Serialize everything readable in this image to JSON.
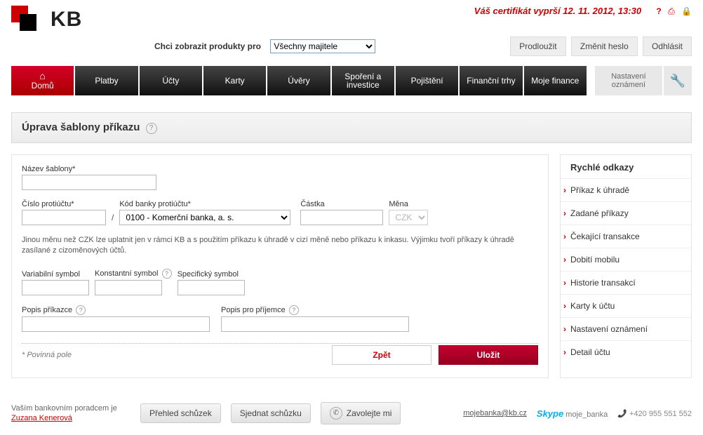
{
  "header": {
    "logo_text": "KB",
    "cert_warning": "Váš certifikát vyprší 12. 11. 2012, 13:30",
    "produkty_label": "Chci zobrazit produkty pro",
    "produkty_select": "Všechny majitele",
    "btn_prodlouzit": "Prodloužit",
    "btn_zmenit_heslo": "Změnit heslo",
    "btn_odhlasit": "Odhlásit"
  },
  "nav": {
    "domu": "Domů",
    "platby": "Platby",
    "ucty": "Účty",
    "karty": "Karty",
    "uvery": "Úvěry",
    "sporeni": "Spoření a investice",
    "pojisteni": "Pojištění",
    "trhy": "Finanční trhy",
    "finance": "Moje finance",
    "nastaveni": "Nastavení oznámení"
  },
  "title": "Úprava šablony příkazu",
  "form": {
    "nazev_label": "Název šablony*",
    "cislo_label": "Číslo protiúčtu*",
    "kod_label": "Kód banky protiúčtu*",
    "kod_value": "0100 - Komerční banka, a. s.",
    "castka_label": "Částka",
    "mena_label": "Měna",
    "mena_value": "CZK",
    "note": "Jinou měnu než CZK lze uplatnit jen v rámci KB a s použitím příkazu k úhradě v cizí měně nebo příkazu k inkasu. Výjimku tvoří příkazy k úhradě zasílané z cizoměnových účtů.",
    "vs_label": "Variabilní symbol",
    "ks_label": "Konstantní symbol",
    "ss_label": "Specifický symbol",
    "popis_prikazce_label": "Popis příkazce",
    "popis_prijemce_label": "Popis pro příjemce",
    "req": "* Povinná pole",
    "btn_zpet": "Zpět",
    "btn_ulozit": "Uložit"
  },
  "quick": {
    "title": "Rychlé odkazy",
    "items": [
      "Příkaz k úhradě",
      "Zadané příkazy",
      "Čekající transakce",
      "Dobití mobilu",
      "Historie transakcí",
      "Karty k účtu",
      "Nastavení oznámení",
      "Detail účtu"
    ]
  },
  "footer": {
    "advisor_lead": "Vaším bankovním poradcem je",
    "advisor_name": "Zuzana Kenerová",
    "btn_prehled": "Přehled schůzek",
    "btn_sjednat": "Sjednat schůzku",
    "btn_zavolejte": "Zavolejte mi",
    "email": "mojebanka@kb.cz",
    "skype_label": "moje_banka",
    "tel": "+420 955 551 552"
  }
}
